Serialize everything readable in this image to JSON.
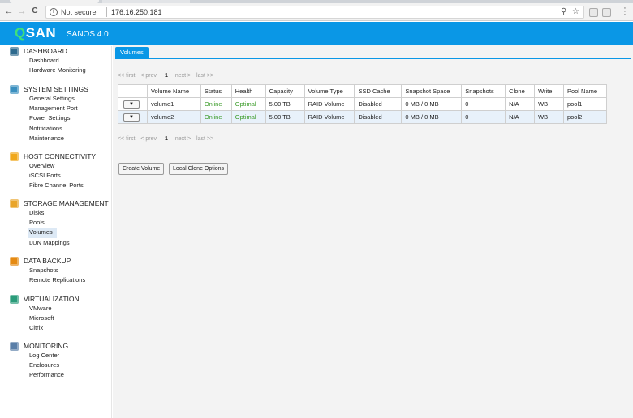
{
  "browser": {
    "nav_back": "←",
    "nav_forward": "→",
    "nav_reload": "C",
    "security_icon": "i",
    "security_label": "Not secure",
    "url": "176.16.250.181",
    "filter_icon": "⚲",
    "star_icon": "☆"
  },
  "app": {
    "logo_q": "Q",
    "logo_rest": "SAN",
    "version": "SANOS 4.0"
  },
  "sidebar": [
    {
      "title": "DASHBOARD",
      "icon_color": "#2e6a8e",
      "items": [
        "Dashboard",
        "Hardware Monitoring"
      ]
    },
    {
      "title": "SYSTEM SETTINGS",
      "icon_color": "#3a8fbf",
      "items": [
        "General Settings",
        "Management Port",
        "Power Settings",
        "Notifications",
        "Maintenance"
      ]
    },
    {
      "title": "HOST CONNECTIVITY",
      "icon_color": "#f0a81c",
      "items": [
        "Overview",
        "iSCSI Ports",
        "Fibre Channel Ports"
      ]
    },
    {
      "title": "STORAGE MANAGEMENT",
      "icon_color": "#e9a52a",
      "items": [
        "Disks",
        "Pools",
        "Volumes",
        "LUN Mappings"
      ]
    },
    {
      "title": "DATA BACKUP",
      "icon_color": "#e58a12",
      "items": [
        "Snapshots",
        "Remote Replications"
      ]
    },
    {
      "title": "VIRTUALIZATION",
      "icon_color": "#2a9c7a",
      "items": [
        "VMware",
        "Microsoft",
        "Citrix"
      ]
    },
    {
      "title": "MONITORING",
      "icon_color": "#5a7fa8",
      "items": [
        "Log Center",
        "Enclosures",
        "Performance"
      ]
    }
  ],
  "active_item": "Volumes",
  "page": {
    "tab_label": "Volumes",
    "pager": {
      "first": "<< first",
      "prev": "< prev",
      "current": "1",
      "next": "next >",
      "last": "last >>"
    },
    "columns": [
      "",
      "Volume Name",
      "Status",
      "Health",
      "Capacity",
      "Volume Type",
      "SSD Cache",
      "Snapshot Space",
      "Snapshots",
      "Clone",
      "Write",
      "Pool Name"
    ],
    "rows": [
      {
        "menu": "▼",
        "name": "volume1",
        "status": "Online",
        "health": "Optimal",
        "capacity": "5.00 TB",
        "type": "RAID Volume",
        "ssd": "Disabled",
        "snap_space": "0 MB / 0 MB",
        "snapshots": "0",
        "clone": "N/A",
        "write": "WB",
        "pool": "pool1"
      },
      {
        "menu": "▼",
        "name": "volume2",
        "status": "Online",
        "health": "Optimal",
        "capacity": "5.00 TB",
        "type": "RAID Volume",
        "ssd": "Disabled",
        "snap_space": "0 MB / 0 MB",
        "snapshots": "0",
        "clone": "N/A",
        "write": "WB",
        "pool": "pool2"
      }
    ],
    "buttons": {
      "create": "Create Volume",
      "clone_options": "Local Clone Options"
    }
  },
  "colors": {
    "accent": "#0a97e6",
    "online": "#3a9b28",
    "logo_q": "#3fe07a"
  }
}
